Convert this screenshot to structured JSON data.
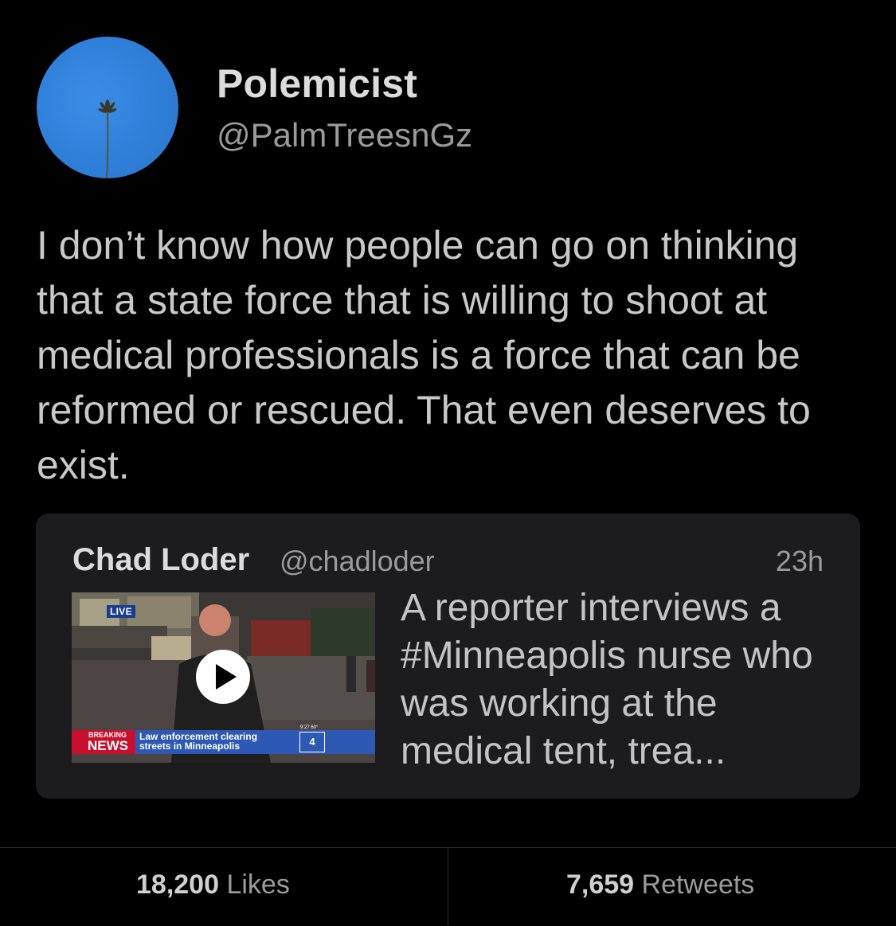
{
  "author": {
    "display_name": "Polemicist",
    "handle": "@PalmTreesnGz"
  },
  "tweet": {
    "text": "I don’t know how people can go on thinking that a state force that is willing to shoot at medical professionals is a force that can be reformed or rescued. That even deserves to exist."
  },
  "quoted_tweet": {
    "display_name": "Chad Loder",
    "handle": "@chadloder",
    "time": "23h",
    "text": "A reporter interviews a #Minneapolis nurse who was working at the medical tent, trea...",
    "video": {
      "live_label": "LIVE",
      "breaking_top": "BREAKING",
      "breaking_bottom": "NEWS",
      "chyron_line1": "Law enforcement clearing",
      "chyron_line2": "streets in Minneapolis",
      "station_logo": "4",
      "time_temp": "9:27  60°"
    }
  },
  "stats": {
    "likes_count": "18,200",
    "likes_label": "Likes",
    "retweets_count": "7,659",
    "retweets_label": "Retweets"
  }
}
